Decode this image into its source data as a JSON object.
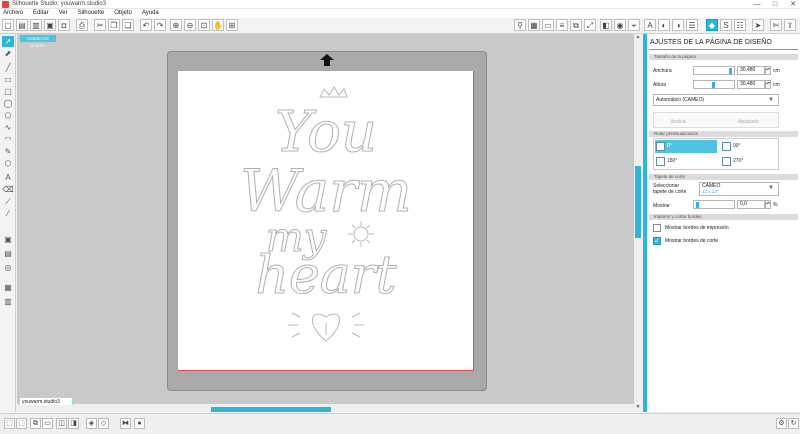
{
  "window": {
    "title": "Silhouette Studio: youwarm.studio3",
    "controls": [
      "—",
      "□",
      "✕"
    ]
  },
  "menu": [
    "Archivo",
    "Editar",
    "Ver",
    "Silhouette",
    "Objeto",
    "Ayuda"
  ],
  "canvas": {
    "tab_label": "DISEÑO DE DISEÑO",
    "artwork": {
      "line1": "You",
      "line2": "Warm",
      "line3": "my",
      "line4": "heart"
    }
  },
  "document_tab": "youwarm.studio3",
  "panel": {
    "title": "AJUSTES DE LA PÁGINA DE DISEÑO",
    "page_size_header": "Tamaño de la página",
    "width_label": "Anchura",
    "width_value": "30,480",
    "width_unit": "cm",
    "height_label": "Altura",
    "height_value": "30,480",
    "height_unit": "cm",
    "page_preset": "Automático (CAMEO)",
    "orientation_vertical": "Vertical",
    "orientation_landscape": "Apaisado",
    "preview_header": "Rotar previsualización",
    "rot_0": "0°",
    "rot_90": "90°",
    "rot_180": "180°",
    "rot_270": "270°",
    "cutting_mat_header": "Tapete de corte",
    "select_mat_label": "Seleccionar tapete de corte",
    "mat_value": "CAMEO",
    "mat_size": "12 x 12\"",
    "show_label": "Mostrar",
    "show_value": "0,0",
    "show_unit": "%",
    "print_borders_header": "Imprimir y cortar bordes",
    "show_print_borders": "Mostrar bordes de impresión",
    "show_cut_borders": "Mostrar bordes de corte",
    "show_print_borders_checked": false,
    "show_cut_borders_checked": true
  },
  "colors": {
    "accent": "#2fb6d6",
    "mat": "#a9a9a9",
    "canvas_bg": "#c9c9c9",
    "cut_border": "#e04a4a"
  }
}
